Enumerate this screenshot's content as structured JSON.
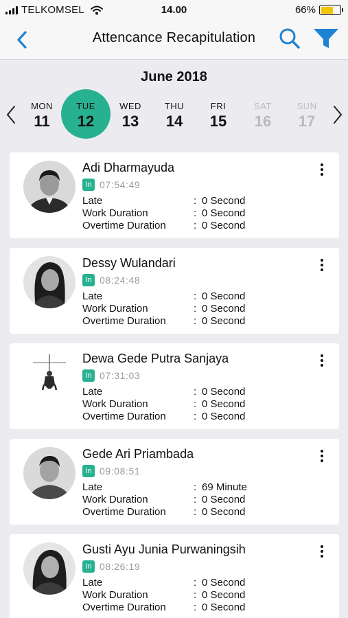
{
  "status_bar": {
    "carrier": "TELKOMSEL",
    "time": "14.00",
    "battery": "66%",
    "battery_level": 0.66,
    "battery_color": "#f5c400"
  },
  "nav": {
    "title": "Attencance Recapitulation",
    "back_icon": "chevron-left-icon",
    "search_icon": "search-icon",
    "filter_icon": "filter-icon",
    "accent": "#1e82d2"
  },
  "calendar": {
    "month": "June 2018",
    "selected_color": "#27b190",
    "days": [
      {
        "name": "MON",
        "num": "11"
      },
      {
        "name": "TUE",
        "num": "12"
      },
      {
        "name": "WED",
        "num": "13"
      },
      {
        "name": "THU",
        "num": "14"
      },
      {
        "name": "FRI",
        "num": "15"
      },
      {
        "name": "SAT",
        "num": "16"
      },
      {
        "name": "SUN",
        "num": "17"
      }
    ]
  },
  "labels": {
    "in": "In",
    "late": "Late",
    "work": "Work Duration",
    "overtime": "Overtime Duration",
    "colon": ":"
  },
  "records": [
    {
      "name": "Adi Dharmayuda",
      "time": "07:54:49",
      "late": "0 Second",
      "work": "0 Second",
      "overtime": "0 Second"
    },
    {
      "name": "Dessy Wulandari",
      "time": "08:24:48",
      "late": "0 Second",
      "work": "0 Second",
      "overtime": "0 Second"
    },
    {
      "name": "Dewa Gede Putra Sanjaya",
      "time": "07:31:03",
      "late": "0 Second",
      "work": "0 Second",
      "overtime": "0 Second"
    },
    {
      "name": "Gede Ari Priambada",
      "time": "09:08:51",
      "late": "69 Minute",
      "work": "0 Second",
      "overtime": "0 Second"
    },
    {
      "name": "Gusti Ayu Junia Purwaningsih",
      "time": "08:26:19",
      "late": "0 Second",
      "work": "0 Second",
      "overtime": "0 Second"
    }
  ]
}
